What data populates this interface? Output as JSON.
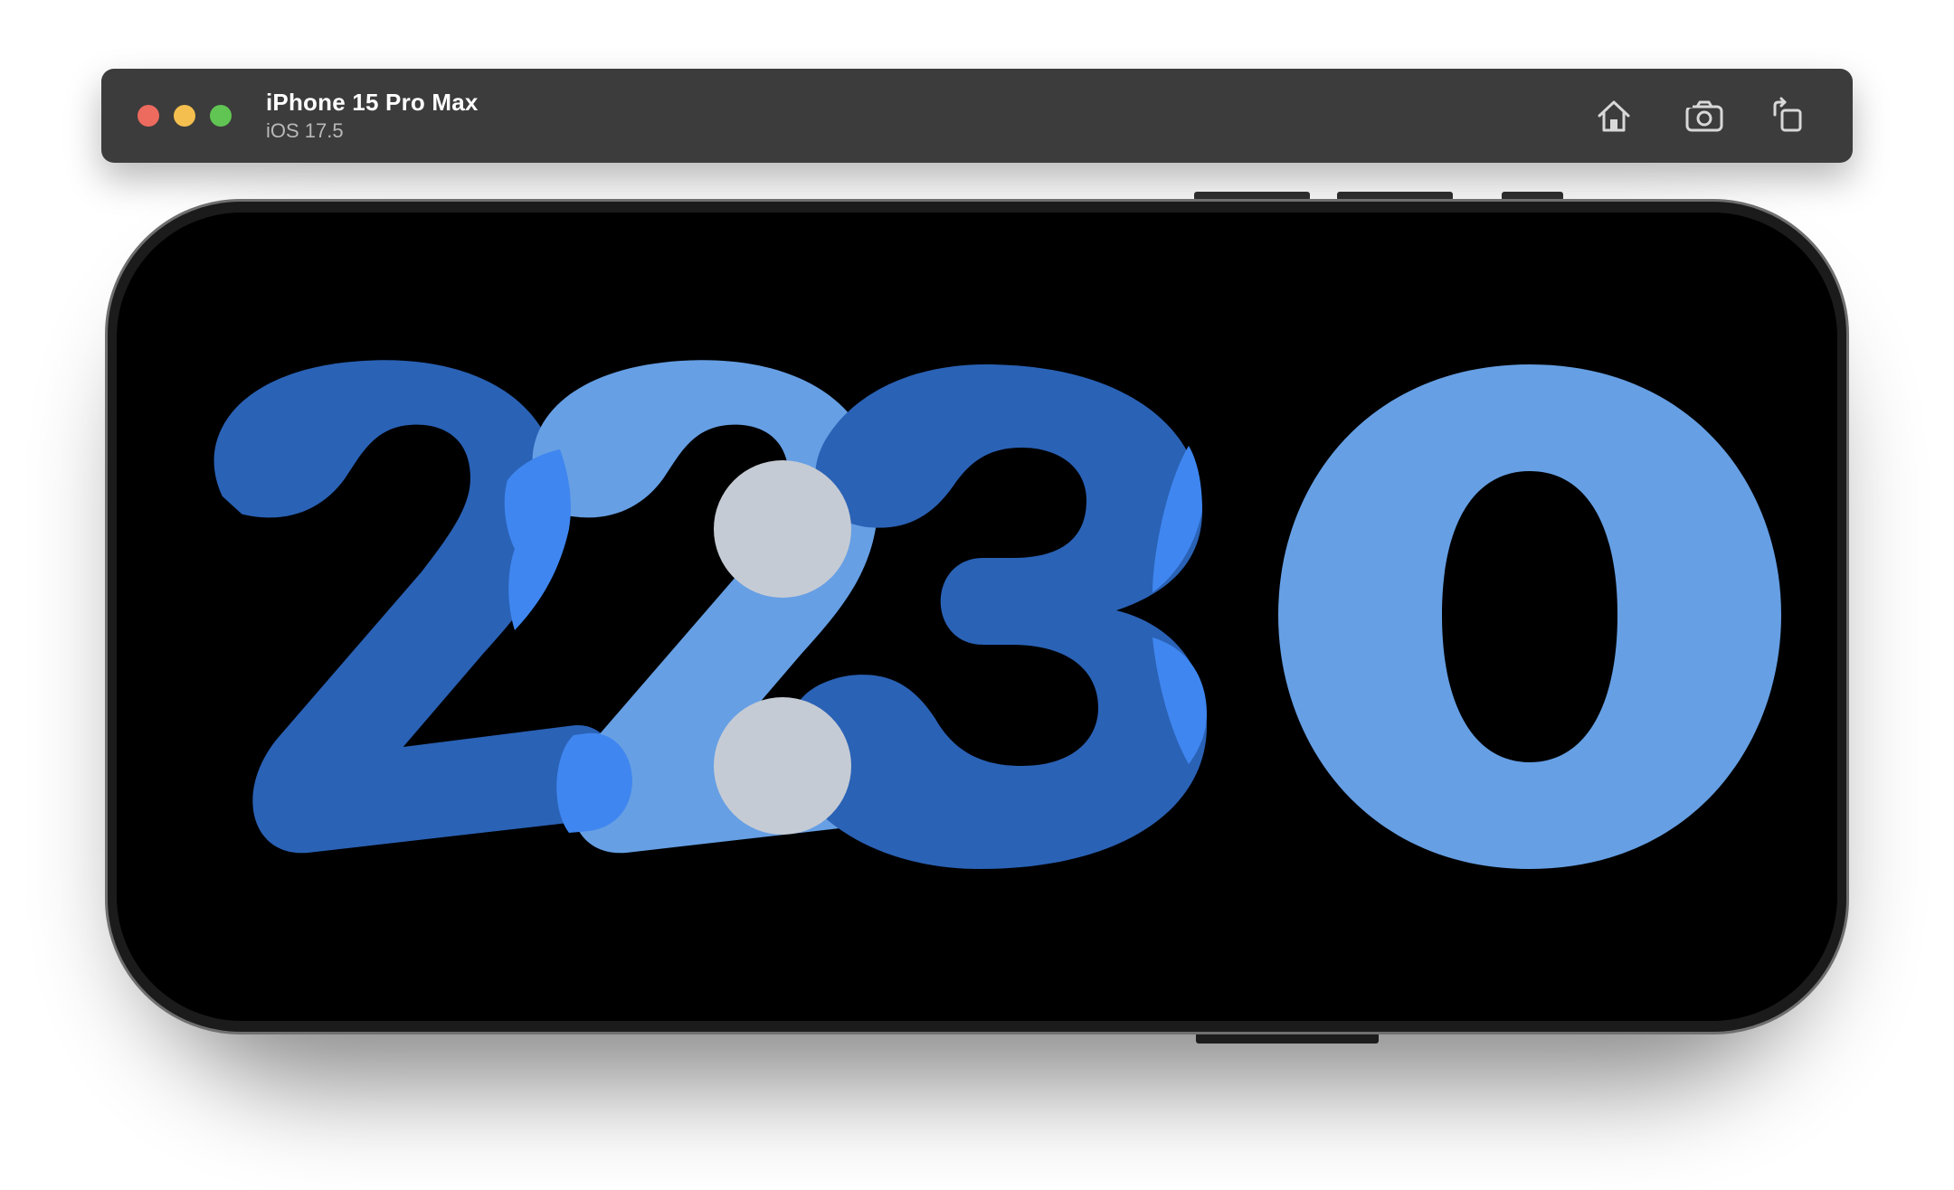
{
  "simulator": {
    "device_name": "iPhone 15 Pro Max",
    "os_version": "iOS 17.5",
    "toolbar": {
      "home_icon": "home-icon",
      "screenshot_icon": "camera-icon",
      "rotate_icon": "rotate-icon"
    },
    "traffic_lights": {
      "close_color": "#ed6a5e",
      "minimize_color": "#f5bf4f",
      "zoom_color": "#61c554"
    }
  },
  "standby_clock": {
    "time": "22:30",
    "digits": [
      "2",
      "2",
      "3",
      "0"
    ],
    "separator": ":",
    "colors": {
      "dark_digit": "#2a62b6",
      "light_digit": "#669fe4",
      "overlap": "#3f86f0",
      "colon": "#c5cbd4",
      "background": "#000000"
    }
  }
}
